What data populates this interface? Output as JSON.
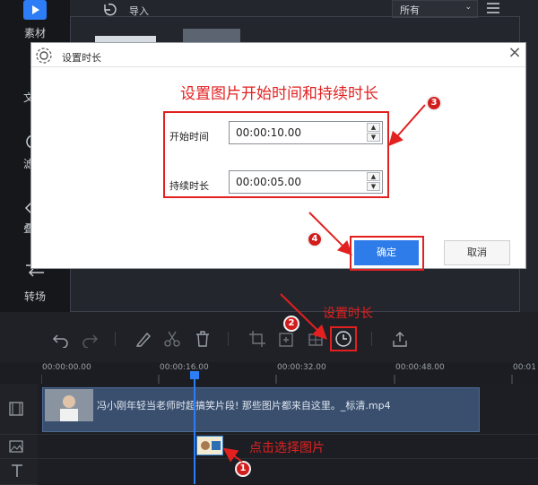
{
  "sidebar": {
    "media_label": "素材",
    "text_label_partial": "文",
    "filter_label_partial": "滤",
    "overlay_label_partial": "叠",
    "transition_label": "转场"
  },
  "media_area": {
    "import_label": "导入",
    "filter_value": "所有"
  },
  "dialog": {
    "title": "设置时长",
    "start_time_label": "开始时间",
    "start_time_value": "00:00:10.00",
    "duration_label": "持续时长",
    "duration_value": "00:00:05.00",
    "ok_label": "确定",
    "cancel_label": "取消"
  },
  "annotations": {
    "dialog_note": "设置图片开始时间和持续时长",
    "set_duration_note": "设置时长",
    "select_image_note": "点击选择图片",
    "badge_1": "1",
    "badge_2": "2",
    "badge_3": "3",
    "badge_4": "4",
    "annotation_color": "#e22020"
  },
  "timeline": {
    "ticks": [
      "00:00:00.00",
      "00:00:16.00",
      "00:00:32.00",
      "00:00:48.00",
      "00:01"
    ],
    "video_clip_label": "冯小刚年轻当老师时超搞笑片段! 那些图片都来自这里。_标清.mp4",
    "playhead_color": "#2d7df6"
  },
  "icons": [
    "media-icon",
    "import-icon",
    "list-icon",
    "gear-icon",
    "close-icon",
    "undo-icon",
    "redo-icon",
    "pen-icon",
    "scissors-icon",
    "trash-icon",
    "crop-icon",
    "zoom-icon",
    "mosaic-icon",
    "clock-icon",
    "export-icon",
    "film-icon",
    "image-icon",
    "text-icon"
  ]
}
